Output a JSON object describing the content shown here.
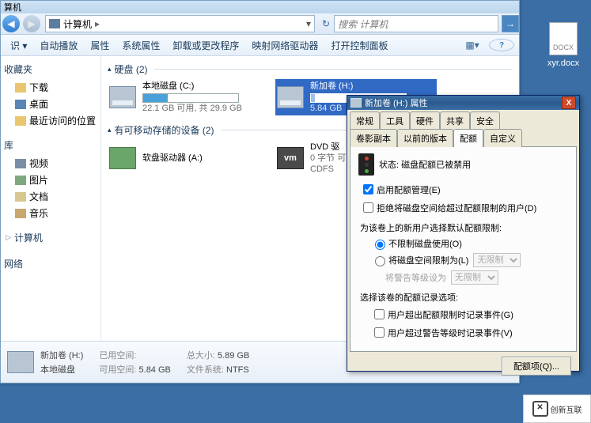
{
  "desktop": {
    "file_label": "xyr.docx",
    "docx_tag": "DOCX"
  },
  "explorer": {
    "title": "算机",
    "address": "计算机",
    "address_suffix": "▸",
    "search_placeholder": "搜索 计算机",
    "toolbar": {
      "organize": "识 ▾",
      "autoplay": "自动播放",
      "props": "属性",
      "sysprops": "系统属性",
      "uninstall": "卸载或更改程序",
      "mapdrive": "映射网络驱动器",
      "ctrlpanel": "打开控制面板"
    },
    "sidebar": {
      "fav_header": "收藏夹",
      "fav": [
        "下载",
        "桌面",
        "最近访问的位置"
      ],
      "lib_header": "库",
      "lib": [
        "视频",
        "图片",
        "文档",
        "音乐"
      ],
      "computer": "计算机",
      "network": "网络"
    },
    "content": {
      "grp_hdd": "硬盘 (2)",
      "grp_removable": "有可移动存储的设备 (2)",
      "c_drive": {
        "title": "本地磁盘 (C:)",
        "sub": "22.1 GB 可用, 共 29.9 GB"
      },
      "h_drive": {
        "title": "新加卷 (H:)",
        "sub": "5.84 GB"
      },
      "floppy": {
        "title": "软盘驱动器 (A:)"
      },
      "dvd": {
        "line1": "DVD 驱",
        "line2": "0 字节 可",
        "line3": "CDFS"
      }
    },
    "status": {
      "name": "新加卷 (H:)",
      "type": "本地磁盘",
      "used_lbl": "已用空间:",
      "used_val": "",
      "free_lbl": "可用空间:",
      "free_val": "5.84 GB",
      "total_lbl": "总大小:",
      "total_val": "5.89 GB",
      "fs_lbl": "文件系统:",
      "fs_val": "NTFS"
    }
  },
  "props": {
    "title": "新加卷 (H:) 属性",
    "tabs_row1": [
      "常规",
      "工具",
      "硬件",
      "共享",
      "安全"
    ],
    "tabs_row2": [
      "卷影副本",
      "以前的版本",
      "配额",
      "自定义"
    ],
    "active_tab": "配额",
    "status_lbl": "状态:",
    "status_val": "磁盘配额已被禁用",
    "cb_enable": "启用配额管理(E)",
    "cb_deny": "拒绝将磁盘空间给超过配额限制的用户(D)",
    "sect1": "为该卷上的新用户选择默认配额限制:",
    "rb_unlimit": "不限制磁盘使用(O)",
    "rb_limit": "将磁盘空间限制为(L)",
    "warn_lbl": "将警告等级设为",
    "dd_unlimit": "无限制",
    "sect2": "选择该卷的配额记录选项:",
    "cb_log1": "用户超出配额限制时记录事件(G)",
    "cb_log2": "用户超过警告等级时记录事件(V)",
    "btn_entries": "配额项(Q)..."
  },
  "watermark": "创新互联"
}
